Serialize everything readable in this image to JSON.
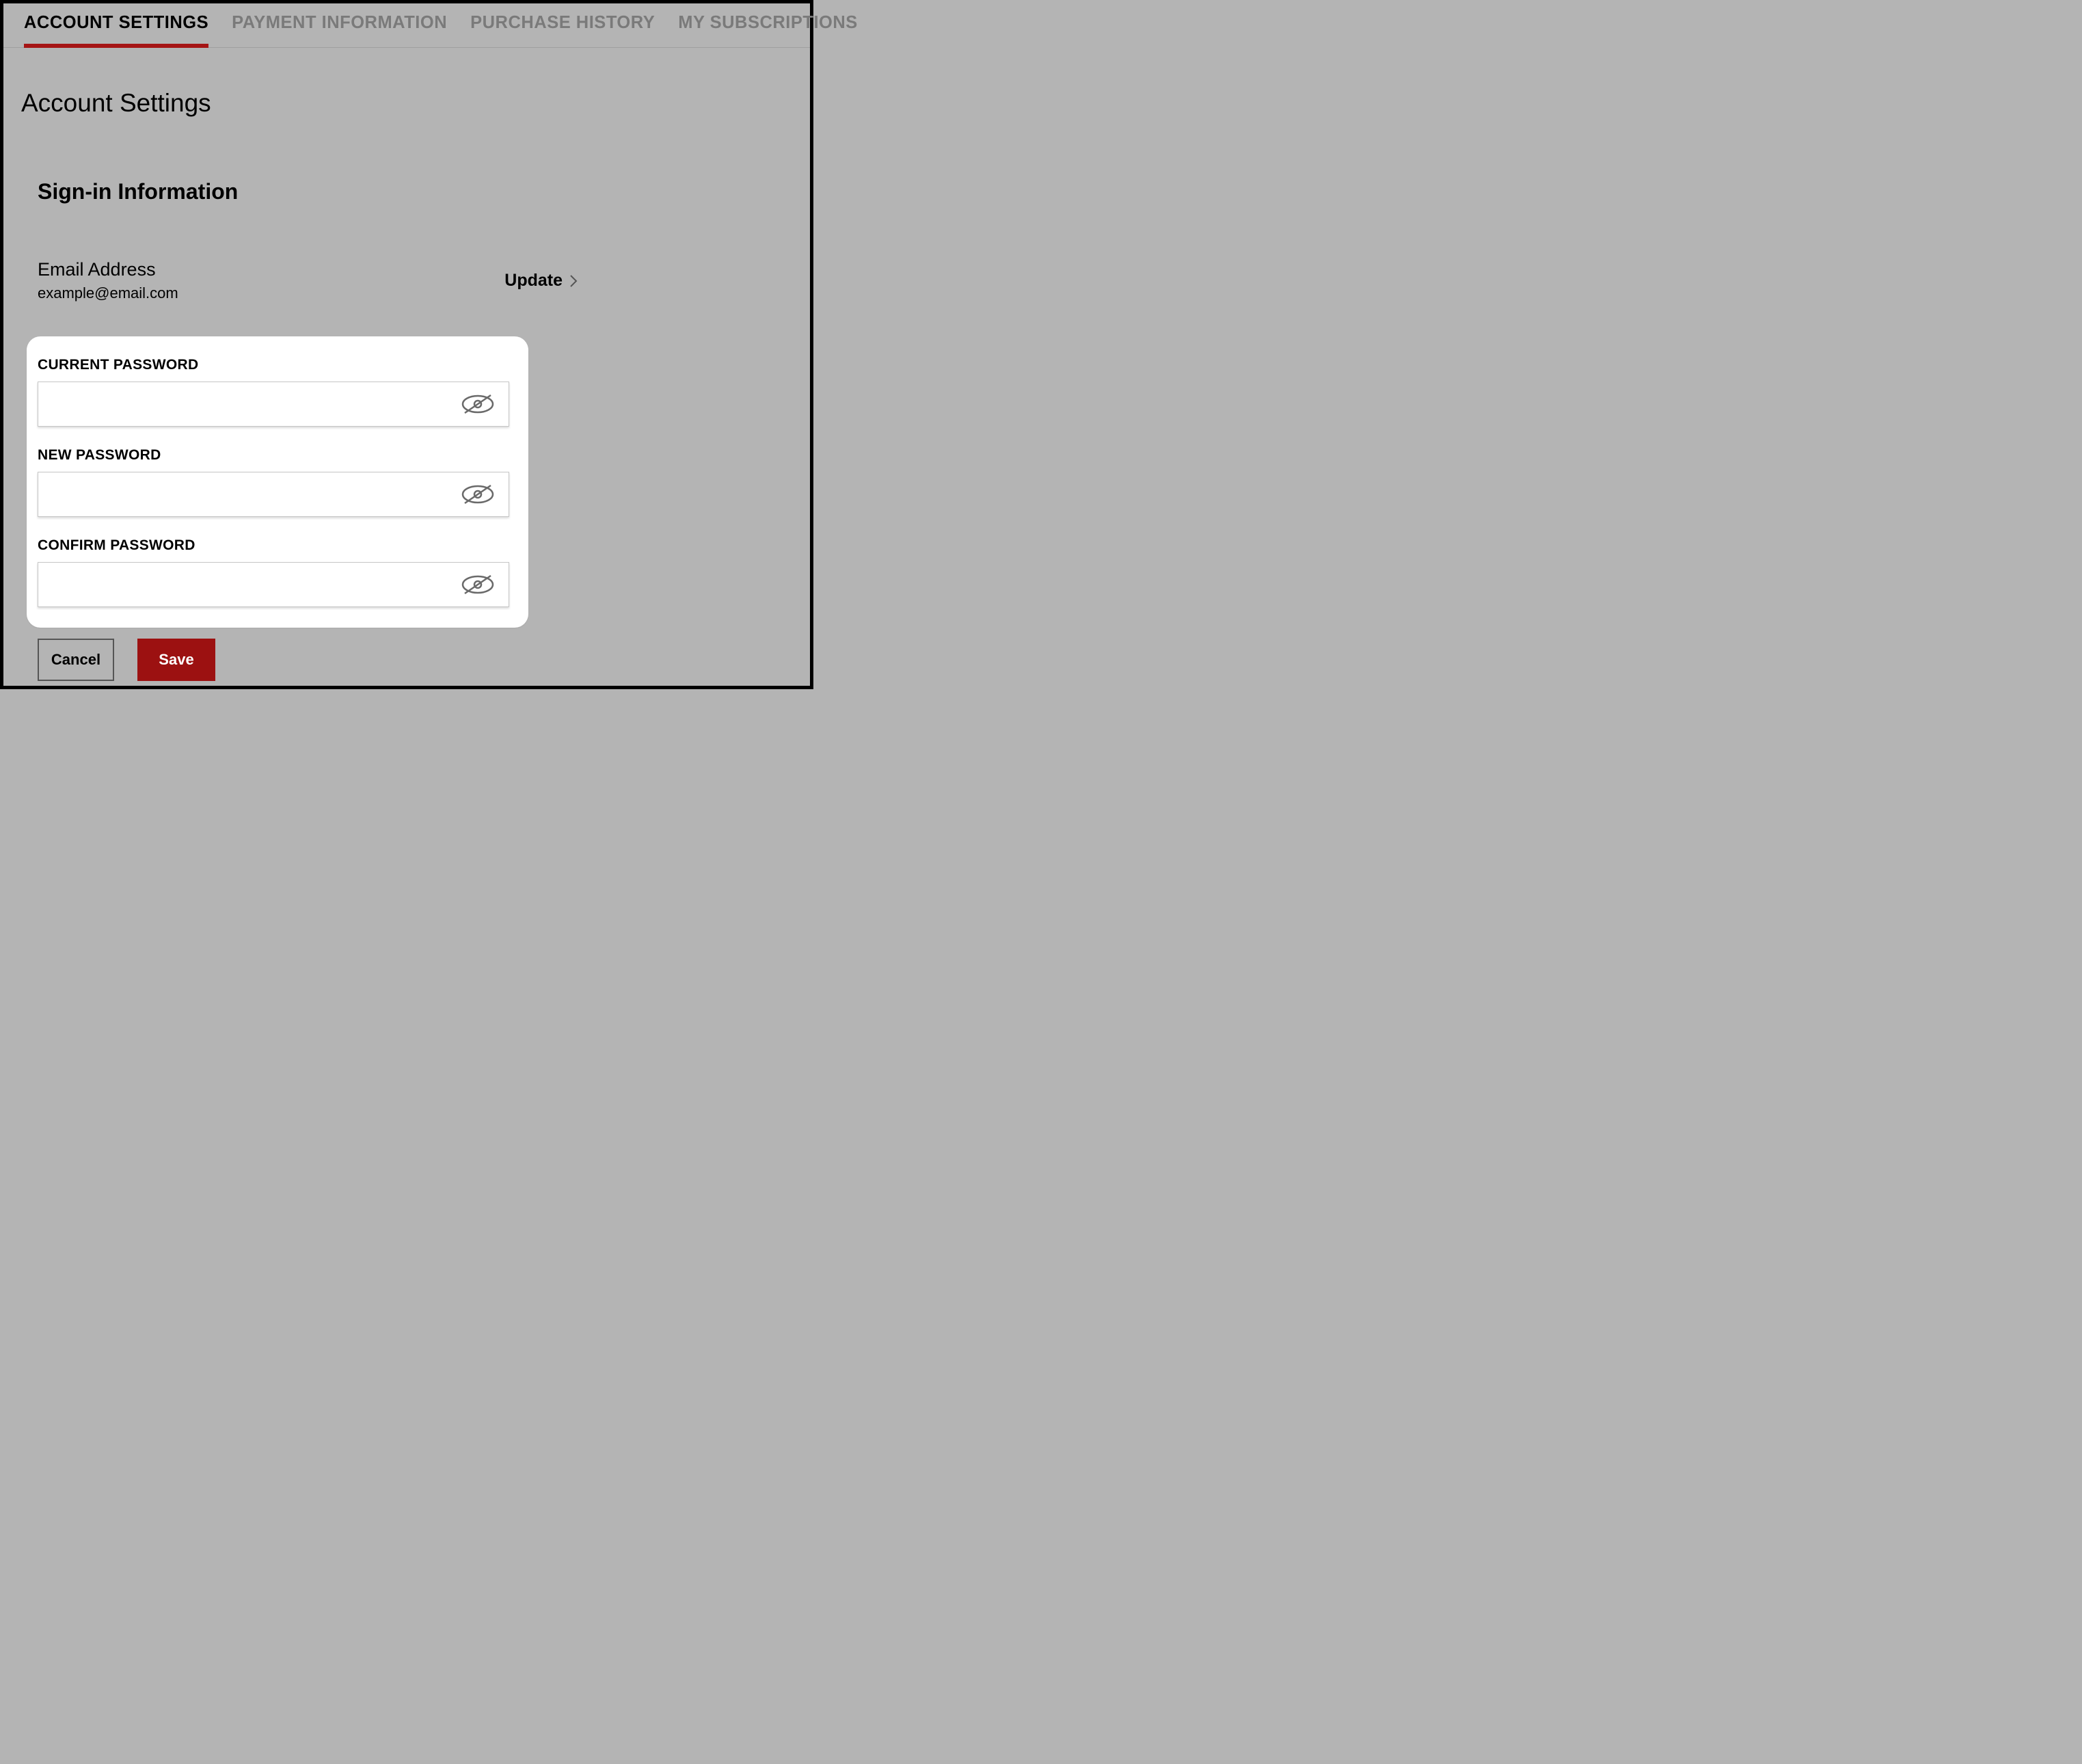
{
  "tabs": {
    "account_settings": "ACCOUNT SETTINGS",
    "payment_information": "PAYMENT INFORMATION",
    "purchase_history": "PURCHASE HISTORY",
    "my_subscriptions": "MY SUBSCRIPTIONS"
  },
  "page_title": "Account Settings",
  "section_title": "Sign-in Information",
  "email": {
    "label": "Email Address",
    "value": "example@email.com",
    "update_label": "Update"
  },
  "password_form": {
    "current_label": "CURRENT PASSWORD",
    "new_label": "NEW PASSWORD",
    "confirm_label": "CONFIRM PASSWORD",
    "current_value": "",
    "new_value": "",
    "confirm_value": ""
  },
  "buttons": {
    "cancel": "Cancel",
    "save": "Save"
  }
}
